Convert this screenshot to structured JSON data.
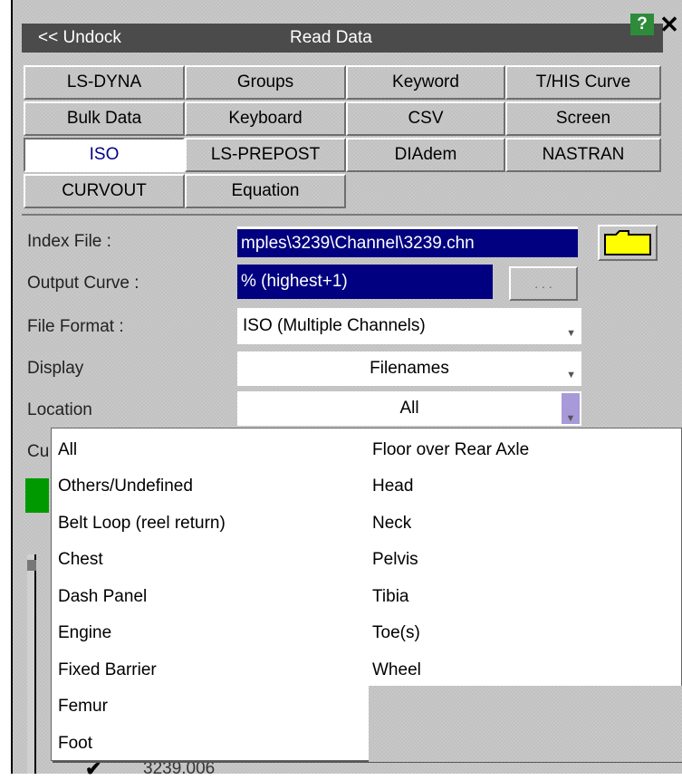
{
  "window": {
    "undock_label": "<< Undock",
    "title": "Read Data",
    "help_label": "?",
    "close_label": "✕"
  },
  "tabs": [
    {
      "label": "LS-DYNA"
    },
    {
      "label": "Groups"
    },
    {
      "label": "Keyword"
    },
    {
      "label": "T/HIS Curve"
    },
    {
      "label": "Bulk Data"
    },
    {
      "label": "Keyboard"
    },
    {
      "label": "CSV"
    },
    {
      "label": "Screen"
    },
    {
      "label": "ISO",
      "active": true
    },
    {
      "label": "LS-PREPOST"
    },
    {
      "label": "DIAdem"
    },
    {
      "label": "NASTRAN"
    },
    {
      "label": "CURVOUT"
    },
    {
      "label": "Equation"
    }
  ],
  "form": {
    "index_file_label": "Index File :",
    "index_file_value": "mples\\3239\\Channel\\3239.chn",
    "output_curve_label": "Output Curve :",
    "output_curve_value": "% (highest+1)",
    "dots_label": ". . .",
    "file_format_label": "File Format :",
    "file_format_value": "ISO (Multiple Channels)",
    "display_label": "Display",
    "display_value": "Filenames",
    "location_label": "Location",
    "location_value": "All",
    "hidden_label_partial": "Cu",
    "list_partial_item": "3239.006"
  },
  "location_dropdown": {
    "left_column": [
      "All",
      "Others/Undefined",
      "Belt Loop (reel return)",
      "Chest",
      "Dash Panel",
      "Engine",
      "Fixed Barrier",
      "Femur",
      "Foot"
    ],
    "right_column": [
      "Floor over Rear Axle",
      "Head",
      "Neck",
      "Pelvis",
      "Tibia",
      "Toe(s)",
      "Wheel"
    ]
  },
  "colors": {
    "title_bar": "#4b4b4b",
    "selection_blue": "#000080",
    "folder_yellow": "#ffff00",
    "help_green": "#2e8b3a",
    "green_button": "#009a00"
  }
}
